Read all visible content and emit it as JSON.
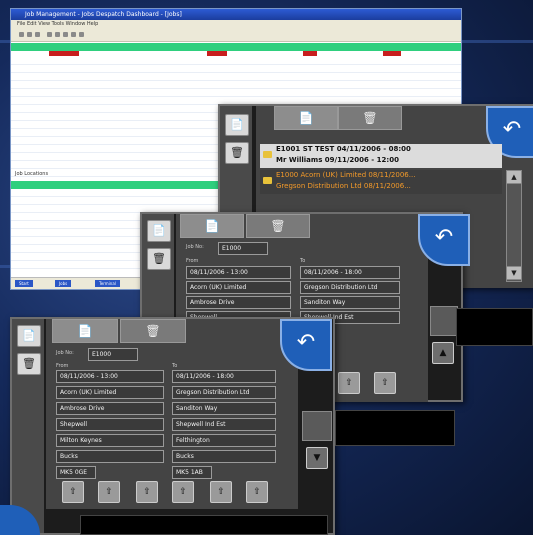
{
  "app_window": {
    "title": "Job Management - Jobs Despatch Dashboard - [Jobs]",
    "menu": "File  Edit  View  Tools  Window  Help",
    "lower_pane_label": "Job Locations",
    "status_buttons": [
      "Start",
      "Jobs",
      "Terminal"
    ]
  },
  "panel_jobs": {
    "job1_line1": "E1001 ST TEST 04/11/2006 - 08:00",
    "job1_line2": "Mr Williams 09/11/2006 - 12:00",
    "job2_line1": "E1000 Acorn (UK) Limited 08/11/2006...",
    "job2_line2": "Gregson Distribution Ltd 08/11/2006..."
  },
  "panel_detail": {
    "job_no_label": "Job No:",
    "job_no": "E1000",
    "from_label": "From",
    "to_label": "To",
    "from_date": "08/11/2006 - 13:00",
    "to_date": "08/11/2006 - 18:00",
    "from_company": "Acorn (UK) Limited",
    "to_company": "Gregson Distribution Ltd",
    "from_addr1": "Ambrose Drive",
    "to_addr1": "Sanditon Way",
    "from_addr2": "Shepwell",
    "to_addr2": "Shepwell Ind Est",
    "from_addr3": "Milton Keynes",
    "to_addr3": "Felthington",
    "from_addr4": "Bucks",
    "to_addr4": "Bucks",
    "from_postcode": "MK5 0GE",
    "to_postcode": "MK5 1AB"
  },
  "icons": {
    "doc": "📄",
    "bin": "🗑",
    "back": "↶",
    "up": "▲",
    "down": "▼",
    "upload": "⇧"
  },
  "colors": {
    "accent_blue": "#1f5fb8",
    "grid_green": "#2fcf7e",
    "orange_text": "#f39a2a"
  }
}
